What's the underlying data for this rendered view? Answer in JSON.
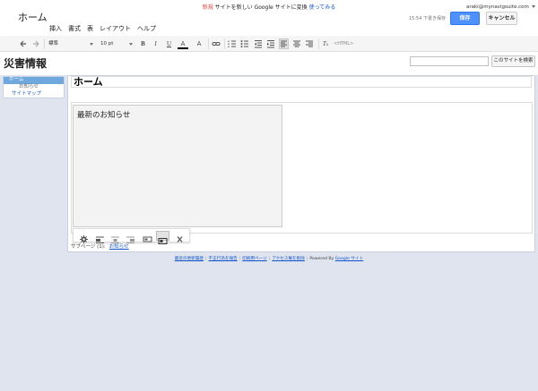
{
  "notice": {
    "prefix": "新規",
    "middle": "サイトを新しい Google サイトに変換",
    "action": "使ってみる"
  },
  "doc_title": "ホーム",
  "menu": [
    "挿入",
    "書式",
    "表",
    "レイアウト",
    "ヘルプ"
  ],
  "user": {
    "email": "araki@mynavigsuite.com"
  },
  "saved_status": "15:54 下書き保存",
  "buttons": {
    "save": "保存",
    "cancel": "キャンセル"
  },
  "toolbar": {
    "style_label": "標準",
    "size_label": "10 pt",
    "bold": "B",
    "italic": "I",
    "underline": "U",
    "text_color": "A",
    "bg_color": "A",
    "html": "<HTML>"
  },
  "site": {
    "title": "災害情報",
    "search_button": "このサイトを検索"
  },
  "nav": {
    "items": [
      {
        "label": "ホーム"
      },
      {
        "label": "お知らせ"
      },
      {
        "label": "サイトマップ"
      }
    ]
  },
  "page": {
    "title": "ホーム",
    "gadget_title": "最新のお知らせ",
    "subpages_label": "サブページ (1):",
    "subpages_link": "お知らせ"
  },
  "footer": {
    "recent": "最近の更新履歴",
    "report": "不正行為を報告",
    "print": "印刷用ページ",
    "access": "アクセス権を削除",
    "powered": "Powered By",
    "google_sites": "Google サイト"
  },
  "colors": {
    "accent": "#4d90fe",
    "nav_selected": "#6fa8dc",
    "link": "#1155cc",
    "new_badge": "#dd4b39",
    "background": "#dfe4ef"
  }
}
